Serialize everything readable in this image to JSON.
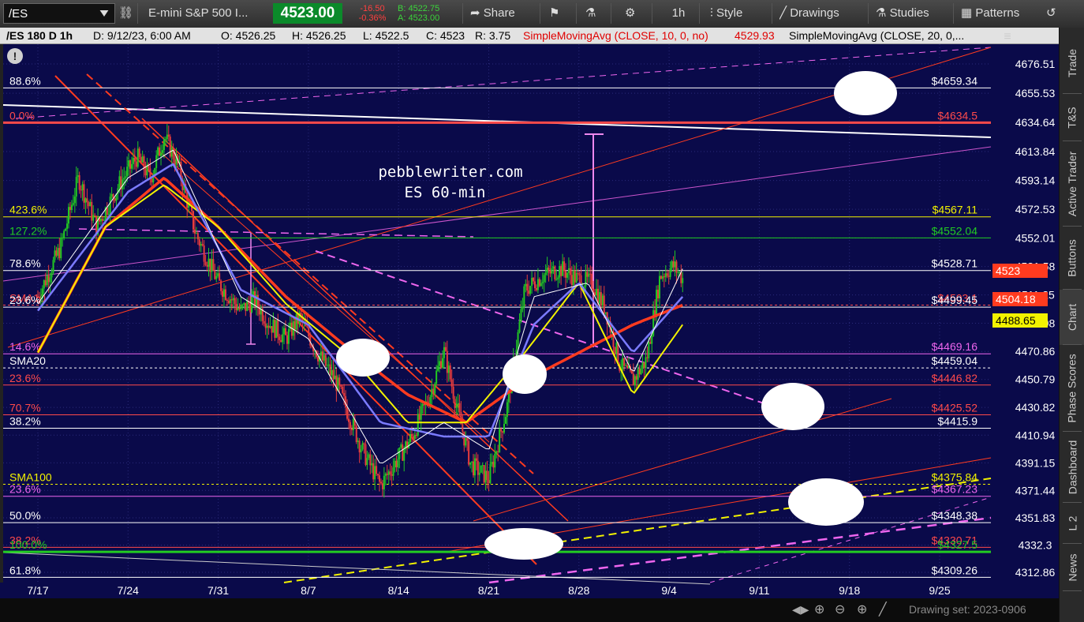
{
  "toolbar": {
    "symbol": "/ES",
    "description": "E-mini S&P 500 I...",
    "last_price": "4523.00",
    "change": "-16.50",
    "change_pct": "-0.36%",
    "bid": "B: 4522.75",
    "ask": "A: 4523.00",
    "share_label": "Share",
    "timeframe_label": "1h",
    "style_label": "Style",
    "drawings_label": "Drawings",
    "studies_label": "Studies",
    "patterns_label": "Patterns"
  },
  "header": {
    "chart_id": "/ES 180 D 1h",
    "date": "D: 9/12/23, 6:00 AM",
    "open": "O: 4526.25",
    "high": "H: 4526.25",
    "low": "L: 4522.5",
    "close": "C: 4523",
    "range": "R: 3.75",
    "sma10_label": "SimpleMovingAvg (CLOSE, 10, 0, no)",
    "sma10_value": "4529.93",
    "sma20_label": "SimpleMovingAvg (CLOSE, 20, 0,..."
  },
  "sidebar": {
    "tabs": [
      "Trade",
      "T&S",
      "Active Trader",
      "Buttons",
      "Chart",
      "Phase Scores",
      "Dashboard",
      "L 2",
      "News"
    ],
    "active": "Chart"
  },
  "watermark": {
    "line1": "pebblewriter.com",
    "line2": "ES 60-min"
  },
  "bottom": {
    "drawing_set": "Drawing set: 2023-0906"
  },
  "chart_data": {
    "type": "candlestick",
    "symbol": "/ES",
    "timeframe": "1h",
    "x_ticks": [
      "7/17",
      "7/24",
      "7/31",
      "8/7",
      "8/14",
      "8/21",
      "8/28",
      "9/4",
      "9/11",
      "9/18",
      "9/25"
    ],
    "y_range": [
      4305,
      4690
    ],
    "y_ticks": [
      4676.51,
      4655.53,
      4634.64,
      4613.84,
      4593.14,
      4572.53,
      4552.01,
      4531.58,
      4511.25,
      4490.98,
      4470.86,
      4450.79,
      4430.82,
      4410.94,
      4391.15,
      4371.44,
      4351.83,
      4332.3,
      4312.86
    ],
    "y_tick_labels": [
      "4676.51",
      "4655.53",
      "4634.64",
      "4613.84",
      "4593.14",
      "4572.53",
      "4552.01",
      "4531.58",
      "4511.25",
      "4490.98",
      "4470.86",
      "4450.79",
      "4430.82",
      "4410.94",
      "4391.15",
      "4371.44",
      "4351.83",
      "4332.3",
      "4312.86"
    ],
    "price_bubbles": [
      {
        "label": "4523",
        "value": 4523,
        "color": "#ff3b1f"
      },
      {
        "label": "4504.18",
        "value": 4504.18,
        "color": "#ff3b1f"
      },
      {
        "label": "4488.65",
        "value": 4488.65,
        "color": "#f2f200"
      }
    ],
    "level_lines": [
      {
        "left_label": "88.6%",
        "right_label": "$4659.34",
        "value": 4659.34,
        "color": "#ffffff"
      },
      {
        "left_label": "0.0%",
        "right_label": "$4634.5",
        "value": 4634.5,
        "color": "#ff4a4a"
      },
      {
        "left_label": "423.6%",
        "right_label": "$4567.11",
        "value": 4567.11,
        "color": "#f2f200"
      },
      {
        "left_label": "127.2%",
        "right_label": "$4552.04",
        "value": 4552.04,
        "color": "#22cc22"
      },
      {
        "left_label": "78.6%",
        "right_label": "$4528.71",
        "value": 4528.71,
        "color": "#ffffff"
      },
      {
        "left_label": "SMA10",
        "right_label": "$4503.1",
        "value": 4504.0,
        "color": "#ff4a4a"
      },
      {
        "left_label": "23.6%",
        "right_label": "$4499.45",
        "value": 4502.5,
        "color": "#ffffff"
      },
      {
        "left_label": "14.6%",
        "right_label": "$4469.16",
        "value": 4469.16,
        "color": "#ee66ee"
      },
      {
        "left_label": "SMA20",
        "right_label": "$4459.04",
        "value": 4459.04,
        "color": "#ffffff"
      },
      {
        "left_label": "23.6%",
        "right_label": "$4446.82",
        "value": 4446.82,
        "color": "#ff4a4a"
      },
      {
        "left_label": "70.7%",
        "right_label": "$4425.52",
        "value": 4425.52,
        "color": "#ff4a4a"
      },
      {
        "left_label": "38.2%",
        "right_label": "$4415.9",
        "value": 4415.9,
        "color": "#ffffff"
      },
      {
        "left_label": "SMA100",
        "right_label": "$4375.84",
        "value": 4375.84,
        "color": "#f2f200"
      },
      {
        "left_label": "23.6%",
        "right_label": "$4367.23",
        "value": 4367.23,
        "color": "#ee66ee"
      },
      {
        "left_label": "50.0%",
        "right_label": "$4348.38",
        "value": 4348.38,
        "color": "#ffffff"
      },
      {
        "left_label": "38.2%",
        "right_label": "$4330.71",
        "value": 4330.71,
        "color": "#ff4a4a"
      },
      {
        "left_label": "100.0%",
        "right_label": "$4327.5",
        "value": 4327.5,
        "color": "#22cc22"
      },
      {
        "left_label": "61.8%",
        "right_label": "$4309.26",
        "value": 4309.26,
        "color": "#ffffff"
      }
    ],
    "price_path": [
      [
        0,
        4510
      ],
      [
        0.05,
        4545
      ],
      [
        0.09,
        4595
      ],
      [
        0.13,
        4560
      ],
      [
        0.18,
        4590
      ],
      [
        0.22,
        4610
      ],
      [
        0.25,
        4595
      ],
      [
        0.28,
        4625
      ],
      [
        0.31,
        4605
      ],
      [
        0.35,
        4555
      ],
      [
        0.4,
        4520
      ],
      [
        0.45,
        4500
      ],
      [
        0.48,
        4508
      ],
      [
        0.51,
        4492
      ],
      [
        0.55,
        4480
      ],
      [
        0.58,
        4495
      ],
      [
        0.62,
        4470
      ],
      [
        0.66,
        4450
      ],
      [
        0.72,
        4400
      ],
      [
        0.76,
        4375
      ],
      [
        0.8,
        4395
      ],
      [
        0.83,
        4410
      ],
      [
        0.87,
        4440
      ],
      [
        0.9,
        4472
      ],
      [
        0.93,
        4430
      ],
      [
        0.96,
        4390
      ],
      [
        1.0,
        4380
      ],
      [
        1.04,
        4430
      ],
      [
        1.08,
        4515
      ],
      [
        1.12,
        4525
      ],
      [
        1.16,
        4530
      ],
      [
        1.2,
        4522
      ],
      [
        1.23,
        4520
      ],
      [
        1.26,
        4500
      ],
      [
        1.29,
        4462
      ],
      [
        1.32,
        4450
      ],
      [
        1.35,
        4465
      ],
      [
        1.38,
        4525
      ],
      [
        1.41,
        4532
      ],
      [
        1.43,
        4523
      ]
    ],
    "sma10_path": [
      [
        0,
        4505
      ],
      [
        0.2,
        4595
      ],
      [
        0.3,
        4615
      ],
      [
        0.45,
        4510
      ],
      [
        0.6,
        4480
      ],
      [
        0.76,
        4390
      ],
      [
        0.9,
        4420
      ],
      [
        1.0,
        4400
      ],
      [
        1.1,
        4510
      ],
      [
        1.22,
        4520
      ],
      [
        1.32,
        4455
      ],
      [
        1.43,
        4530
      ]
    ],
    "sma20_path": [
      [
        0,
        4500
      ],
      [
        0.2,
        4585
      ],
      [
        0.3,
        4605
      ],
      [
        0.45,
        4515
      ],
      [
        0.6,
        4490
      ],
      [
        0.76,
        4420
      ],
      [
        0.9,
        4410
      ],
      [
        1.0,
        4410
      ],
      [
        1.1,
        4490
      ],
      [
        1.2,
        4520
      ],
      [
        1.32,
        4470
      ],
      [
        1.43,
        4510
      ]
    ],
    "sma50_path": [
      [
        0,
        4470
      ],
      [
        0.15,
        4560
      ],
      [
        0.28,
        4590
      ],
      [
        0.4,
        4560
      ],
      [
        0.55,
        4505
      ],
      [
        0.7,
        4465
      ],
      [
        0.82,
        4420
      ],
      [
        0.95,
        4420
      ],
      [
        1.08,
        4470
      ],
      [
        1.2,
        4520
      ],
      [
        1.32,
        4440
      ],
      [
        1.43,
        4490
      ]
    ],
    "sma100_path": [
      [
        0,
        4470
      ],
      [
        0.15,
        4560
      ],
      [
        0.28,
        4595
      ],
      [
        0.4,
        4560
      ],
      [
        0.55,
        4510
      ],
      [
        0.7,
        4470
      ],
      [
        0.82,
        4440
      ],
      [
        0.95,
        4420
      ],
      [
        1.08,
        4450
      ],
      [
        1.2,
        4470
      ],
      [
        1.32,
        4490
      ],
      [
        1.43,
        4504
      ]
    ],
    "colors": {
      "background": "#0a0a4a",
      "candle_up": "#22c822",
      "candle_down": "#e63c3c",
      "sma10": "#ffffff",
      "sma20": "#7b7bff",
      "sma50": "#f2f200",
      "sma100": "#ff3b1f"
    }
  }
}
